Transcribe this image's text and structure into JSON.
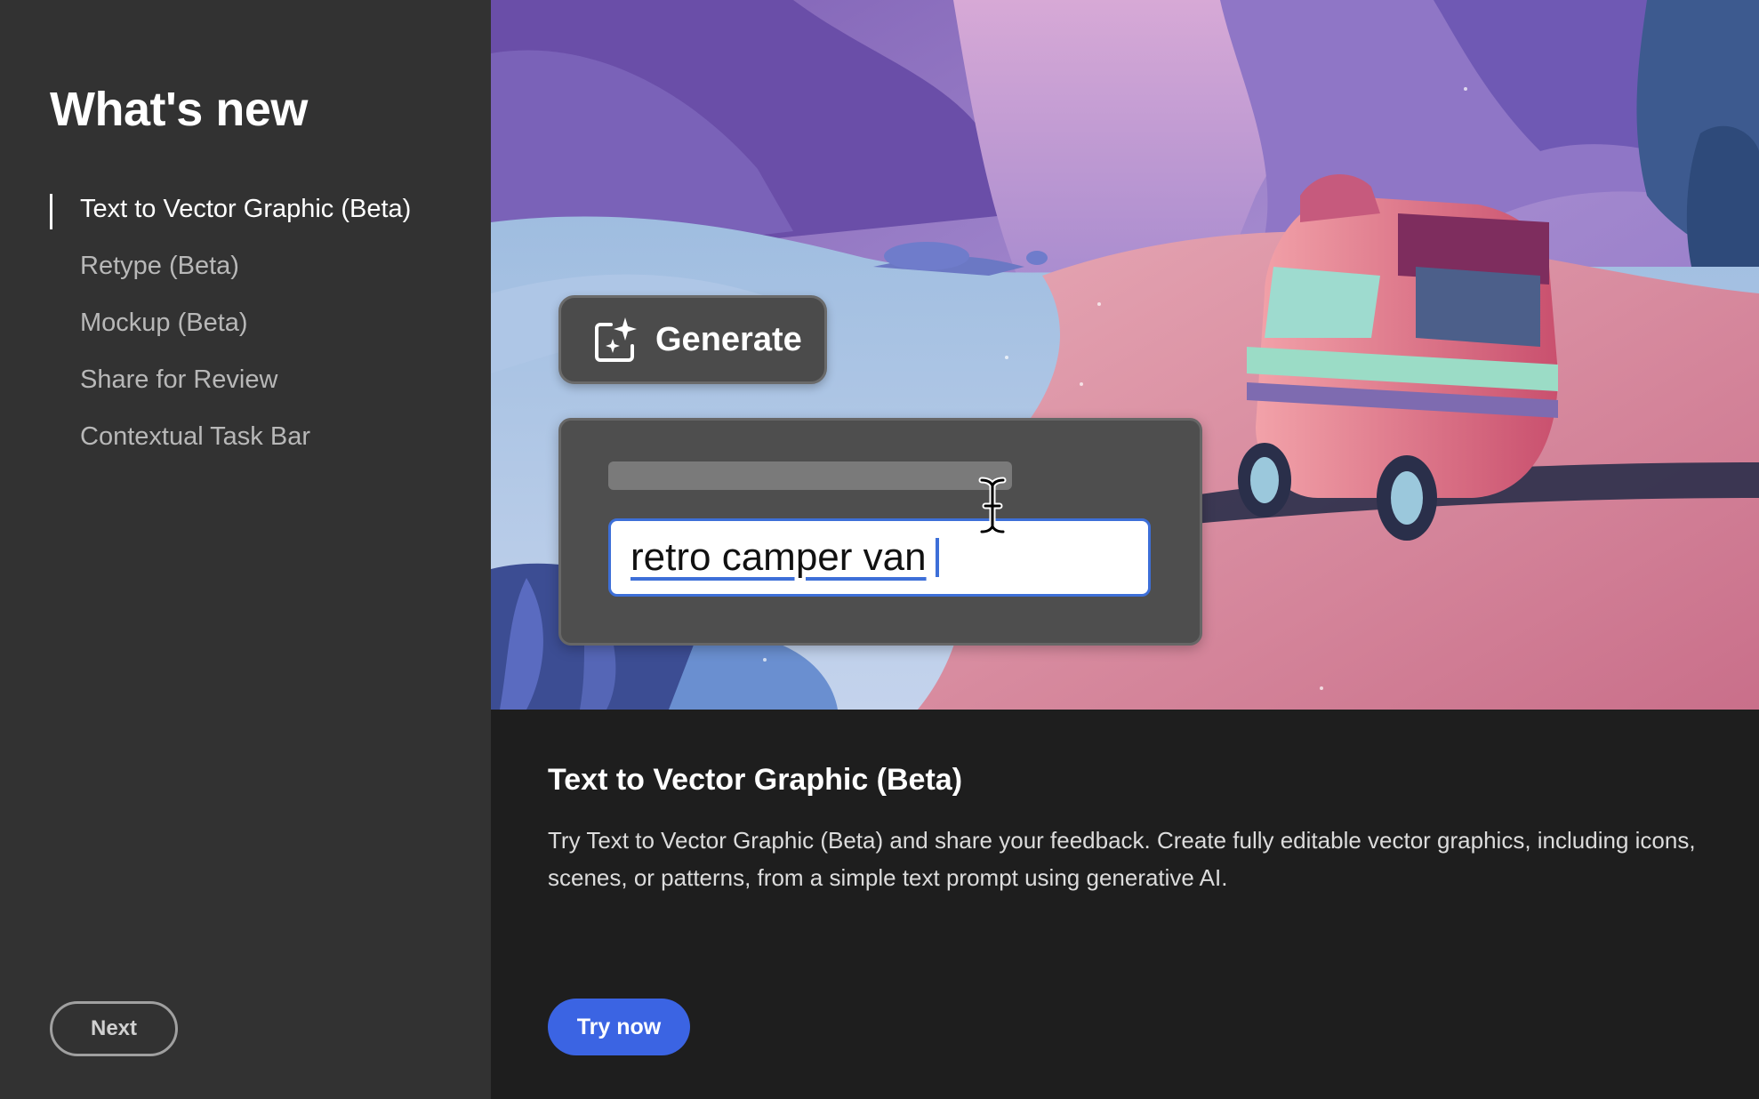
{
  "sidebar": {
    "title": "What's new",
    "items": [
      {
        "label": "Text to Vector Graphic (Beta)",
        "active": true
      },
      {
        "label": "Retype (Beta)",
        "active": false
      },
      {
        "label": "Mockup (Beta)",
        "active": false
      },
      {
        "label": "Share for Review",
        "active": false
      },
      {
        "label": "Contextual Task Bar",
        "active": false
      }
    ],
    "next_label": "Next"
  },
  "hero": {
    "generate_label": "Generate",
    "generate_icon": "sparkle-frame-icon",
    "prompt_value": "retro camper van",
    "cursor_icon": "text-cursor-icon"
  },
  "feature": {
    "title": "Text to Vector Graphic (Beta)",
    "description": "Try Text to Vector Graphic (Beta) and share your feedback. Create fully editable vector graphics, including icons, scenes, or patterns, from a simple text prompt using generative AI.",
    "cta_label": "Try now"
  },
  "colors": {
    "sidebar_bg": "#323232",
    "content_bg": "#1e1e1e",
    "accent": "#3b64e3",
    "input_focus": "#3d6fd8"
  }
}
